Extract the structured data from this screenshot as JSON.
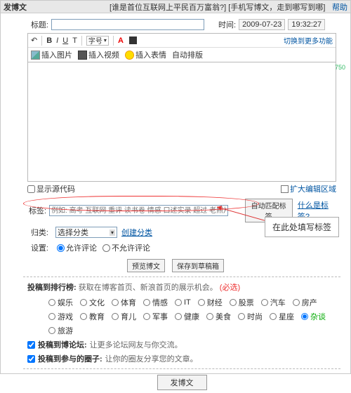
{
  "topbar": {
    "title": "发博文",
    "link1": "[谁是首位互联网上平民百万富翁?]",
    "link2": "[手机写博文，走到哪写到哪]",
    "help": "帮助"
  },
  "title": {
    "label": "标题:",
    "time_label": "时间:",
    "date": "2009-07-23",
    "time": "19:32:27"
  },
  "toolbar": {
    "font": "字号",
    "switch": "切换到更多功能",
    "img": "插入图片",
    "vid": "插入视频",
    "face": "插入表情",
    "auto": "自动排版"
  },
  "editor": {
    "wc": "750"
  },
  "below": {
    "showcode": "显示源代码",
    "expand": "扩大编辑区域"
  },
  "tags": {
    "label": "标签:",
    "placeholder": "例如: 高考 互联网 重评 读书卷 情感 口述实录 超过 老照片",
    "auto": "自动匹配标签",
    "what": "什么是标签?"
  },
  "callout": "在此处填写标签",
  "category": {
    "label": "归类:",
    "selected": "选择分类",
    "create": "创建分类"
  },
  "settings": {
    "label": "设置:",
    "allow": "允许评论",
    "disallow": "不允许评论"
  },
  "actions": {
    "preview": "预览博文",
    "draft": "保存到草稿箱"
  },
  "rank": {
    "title": "投稿到排行榜:",
    "desc": "获取在博客首页、新浪首页的展示机会。",
    "req": "(必选)"
  },
  "cats": [
    "娱乐",
    "文化",
    "体育",
    "情感",
    "IT",
    "财经",
    "股票",
    "汽车",
    "房产",
    "游戏",
    "教育",
    "育儿",
    "军事",
    "健康",
    "美食",
    "时尚",
    "星座",
    "杂谈",
    "旅游"
  ],
  "cats_checked": "杂谈",
  "forum": {
    "title": "投稿到博论坛:",
    "desc": "让更多论坛网友与你交流。"
  },
  "circle": {
    "title": "投稿到参与的圈子:",
    "desc": "让你的圈友分享您的文章。"
  },
  "publish": "发博文"
}
